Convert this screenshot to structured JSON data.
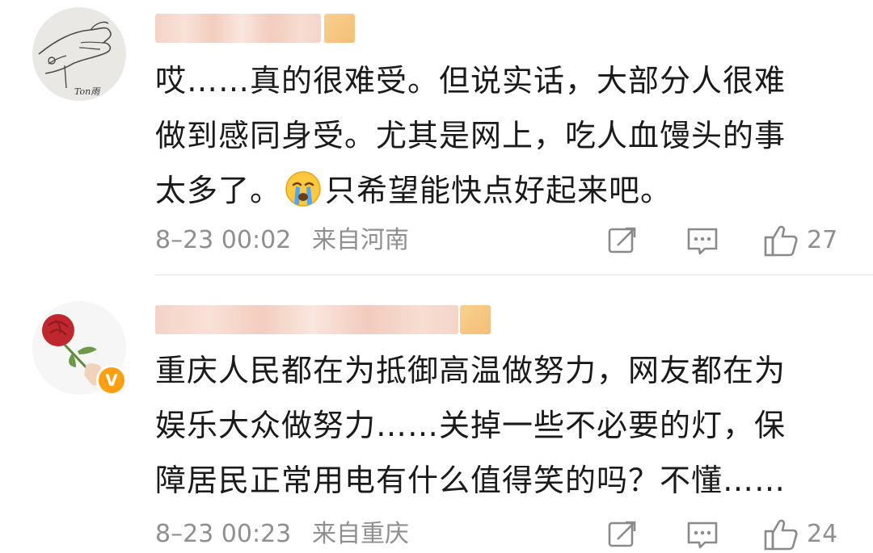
{
  "comments": [
    {
      "text_lines": [
        "哎……真的很难受。但说实话，大部分人很难",
        "做到感同身受。尤其是网上，吃人血馒头的事",
        "太多了。",
        "只希望能快点好起来吧。"
      ],
      "emoji": "crying-face",
      "time": "8–23 00:02",
      "location": "来自河南",
      "likes": "27",
      "avatar_caption": "Ton雨"
    },
    {
      "text_lines": [
        "重庆人民都在为抵御高温做努力，网友都在为",
        "娱乐大众做努力……关掉一些不必要的灯，保",
        "障居民正常用电有什么值得笑的吗？不懂……"
      ],
      "time": "8–23 00:23",
      "location": "来自重庆",
      "likes": "24",
      "verified_badge": "V"
    }
  ],
  "colors": {
    "text": "#1a1a1a",
    "meta": "#8f8f8f",
    "verified": "#ff9f10",
    "divider": "#e6e6e6"
  }
}
